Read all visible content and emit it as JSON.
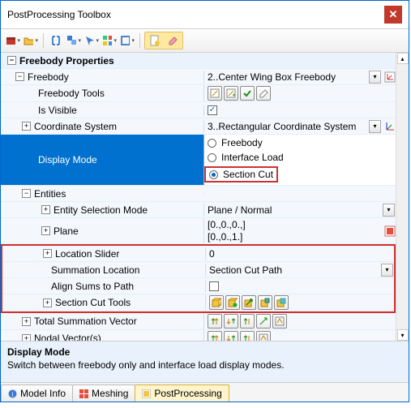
{
  "window": {
    "title": "PostProcessing Toolbox",
    "close": "✕"
  },
  "sections": {
    "freebody_properties": "Freebody Properties",
    "freebody": "Freebody",
    "freebody_value": "2..Center Wing Box Freebody",
    "freebody_tools": "Freebody Tools",
    "is_visible": "Is Visible",
    "coord_sys": "Coordinate System",
    "coord_sys_value": "3..Rectangular Coordinate System",
    "display_mode": "Display Mode",
    "radio_freebody": "Freebody",
    "radio_interface": "Interface Load",
    "radio_section": "Section Cut",
    "entities": "Entities",
    "entity_sel_mode": "Entity Selection Mode",
    "entity_sel_value": "Plane / Normal",
    "plane": "Plane",
    "plane_value_1": "[0.,0.,0.,]",
    "plane_value_2": "[0.,0.,1.]",
    "location_slider": "Location Slider",
    "location_value": "0",
    "sum_location": "Summation Location",
    "sum_value": "Section Cut Path",
    "align_sums": "Align Sums to Path",
    "section_cut_tools": "Section Cut Tools",
    "total_sum_vec": "Total Summation Vector",
    "nodal_vec": "Nodal Vector(s)"
  },
  "description": {
    "title": "Display Mode",
    "body": "Switch between freebody only and interface load display modes."
  },
  "tabs": {
    "model_info": "Model Info",
    "meshing": "Meshing",
    "postproc": "PostProcessing"
  },
  "glyph": {
    "plus": "+",
    "minus": "−",
    "check": "✓",
    "down": "▾",
    "up": "▴"
  }
}
